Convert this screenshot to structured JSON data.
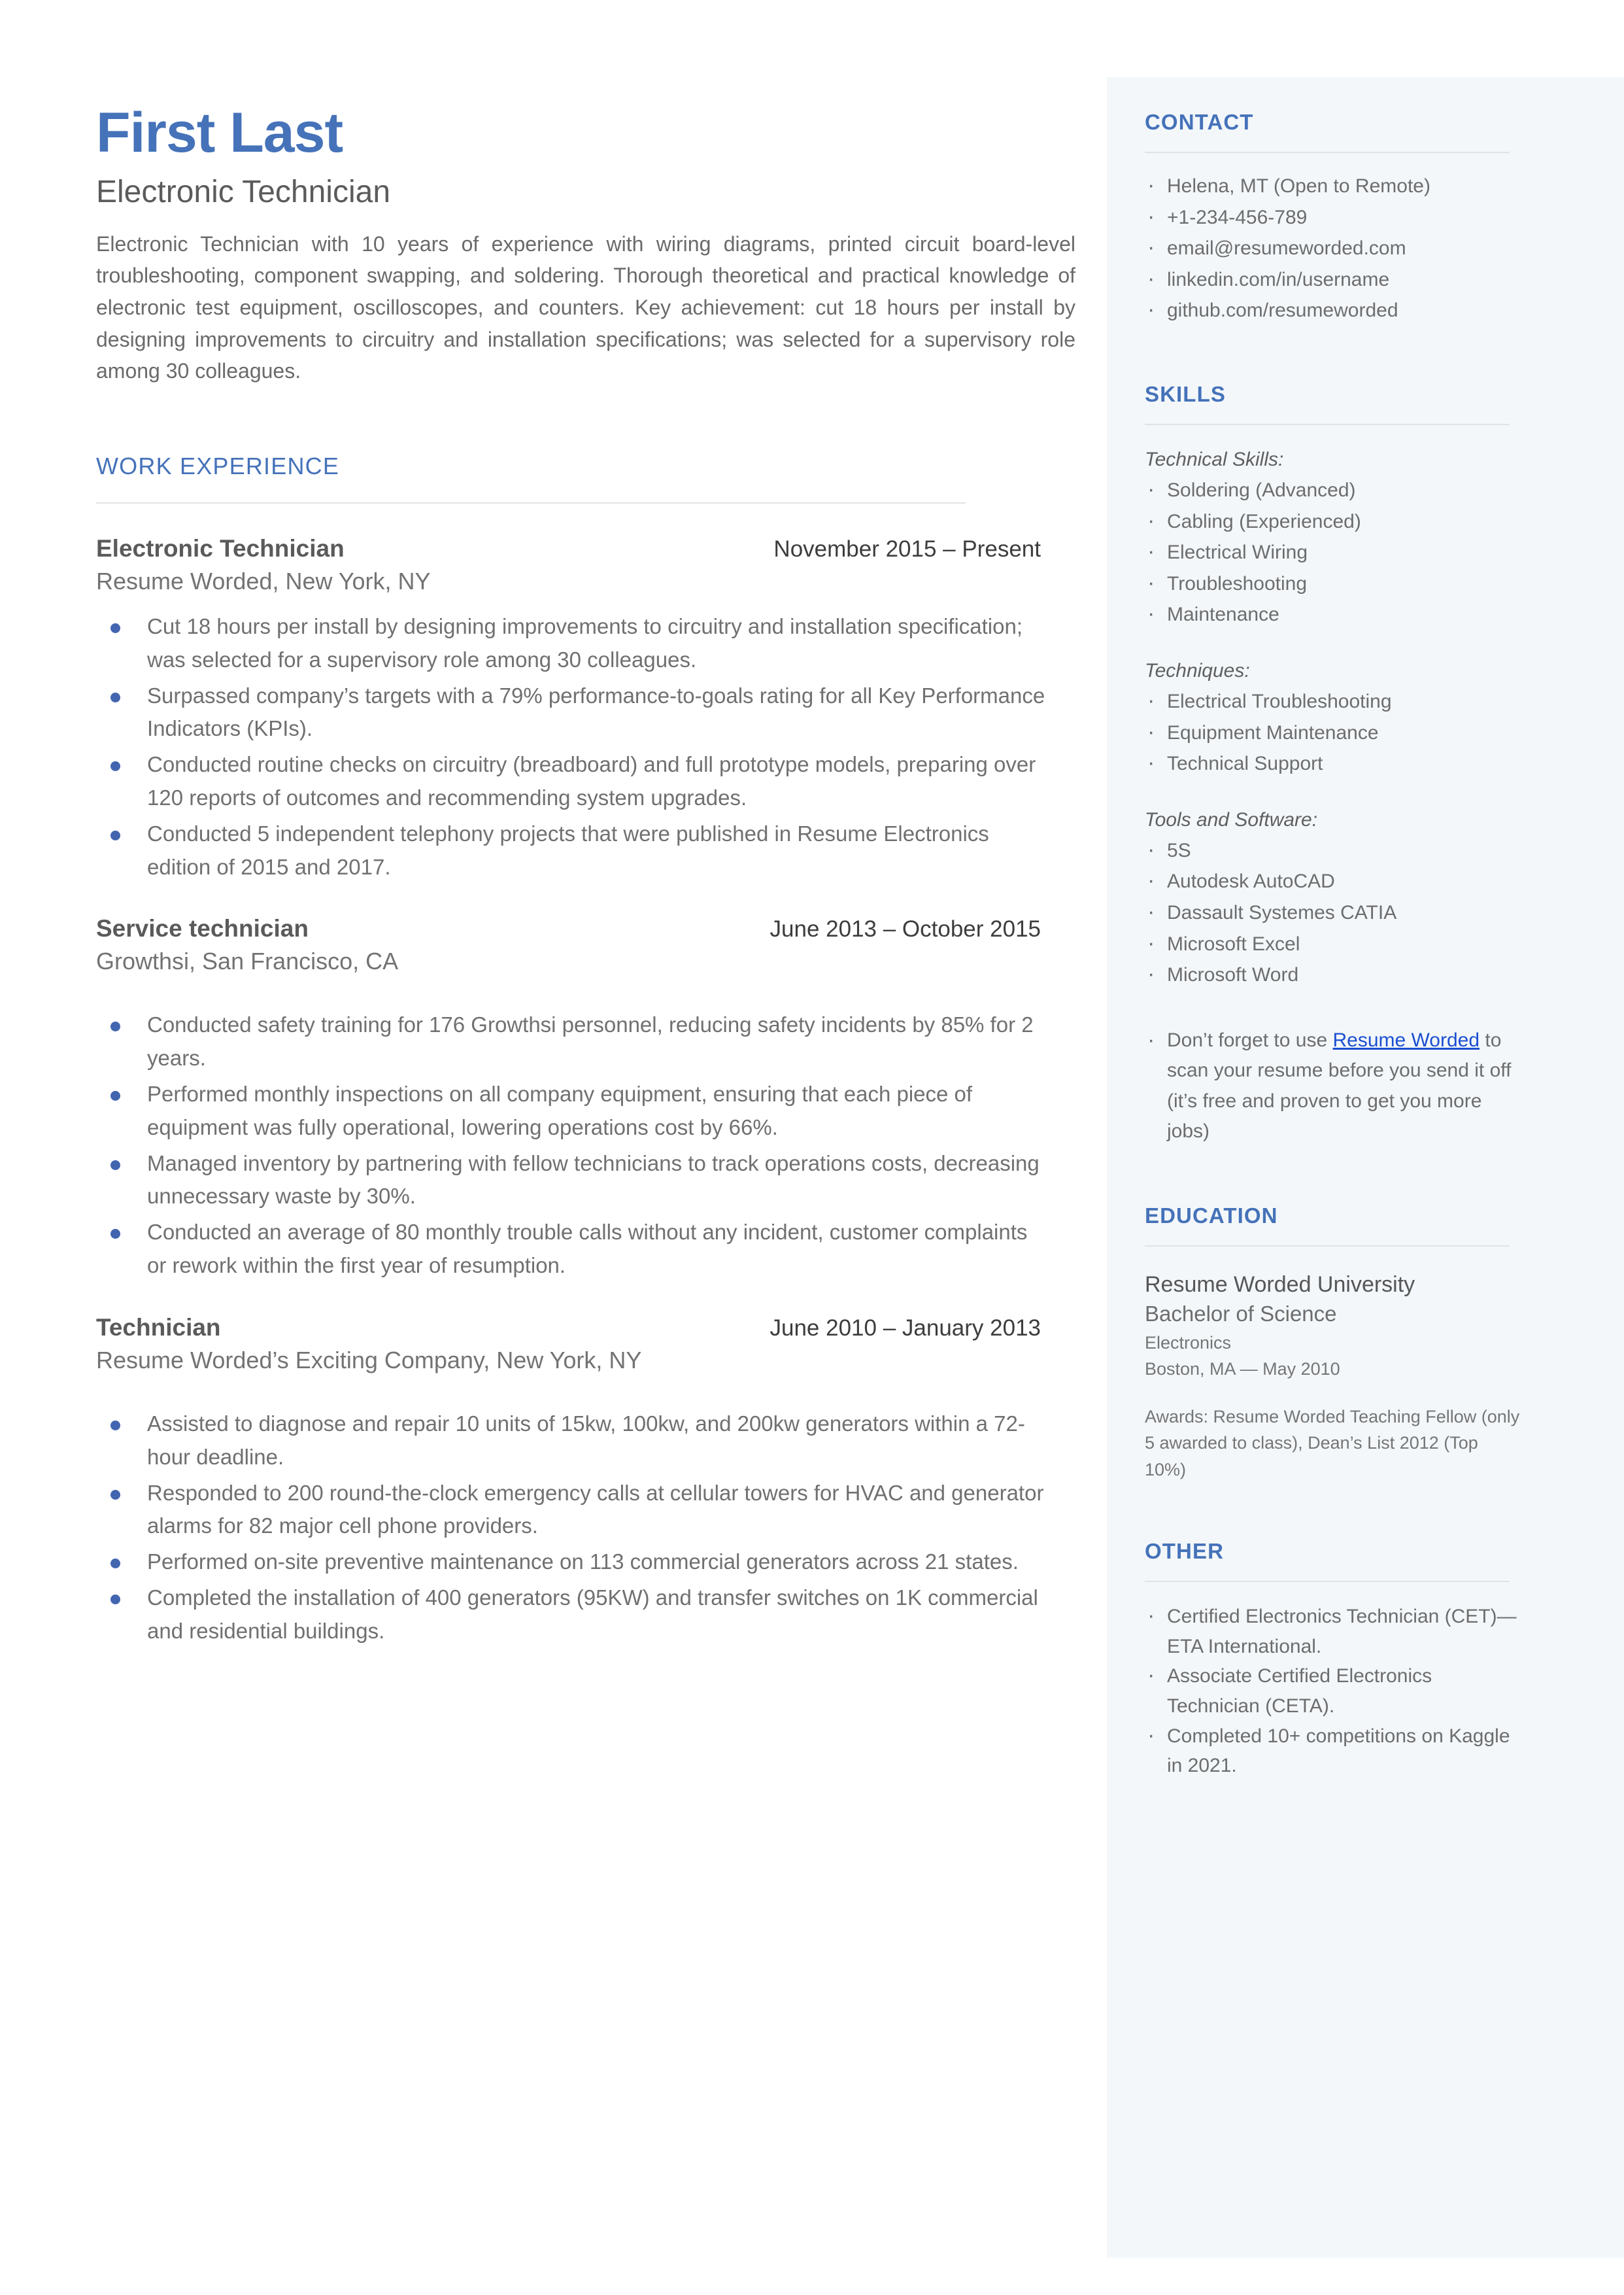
{
  "theme": {
    "accent_blue": "#4572b9",
    "bullet_blue": "#4265b0",
    "link_blue": "#1b4fd1",
    "sidebar_bg": "#f3f7fa",
    "body_text": "#6d6d6d"
  },
  "header": {
    "name": "First Last",
    "title": "Electronic Technician",
    "summary": "Electronic Technician with 10 years of experience with wiring diagrams, printed circuit board-level troubleshooting, component swapping, and soldering. Thorough theoretical and practical knowledge of electronic test equipment, oscilloscopes, and counters. Key achievement: cut 18 hours per install by designing improvements to circuitry and installation specifications; was selected for a supervisory role among 30 colleagues."
  },
  "work_experience": {
    "heading": "WORK EXPERIENCE",
    "jobs": [
      {
        "role": "Electronic Technician",
        "dates": "November 2015 – Present",
        "company": "Resume Worded, New York, NY",
        "bullets": [
          "Cut 18 hours per install by designing improvements to circuitry and installation specification; was selected for a supervisory role among 30 colleagues.",
          "Surpassed company’s targets with a 79% performance-to-goals rating for all Key Performance Indicators (KPIs).",
          "Conducted routine checks on circuitry (breadboard) and full prototype models, preparing over 120 reports of outcomes and recommending system upgrades.",
          "Conducted 5 independent telephony projects that were published in Resume Electronics edition of 2015 and 2017."
        ]
      },
      {
        "role": "Service technician",
        "dates": "June 2013 – October 2015",
        "company": "Growthsi, San Francisco, CA",
        "bullets": [
          "Conducted safety training for 176 Growthsi personnel, reducing safety incidents by 85% for 2 years.",
          "Performed monthly inspections on all company equipment, ensuring that each piece of equipment was fully operational, lowering operations cost by 66%.",
          "Managed inventory by partnering with fellow technicians to track operations costs, decreasing unnecessary waste by 30%.",
          "Conducted an average of 80 monthly trouble calls without any incident, customer complaints or rework within the first year of resumption."
        ]
      },
      {
        "role": "Technician",
        "dates": "June 2010 – January 2013",
        "company": "Resume Worded’s Exciting Company, New York, NY",
        "bullets": [
          "Assisted to diagnose and repair 10 units of 15kw, 100kw, and 200kw generators within a 72-hour deadline.",
          "Responded to 200 round-the-clock emergency calls at cellular towers for HVAC and generator alarms for 82 major cell phone providers.",
          "Performed on-site preventive maintenance on 113 commercial generators across 21 states.",
          "Completed the installation of 400 generators (95KW) and transfer switches on 1K commercial and residential buildings."
        ]
      }
    ]
  },
  "contact": {
    "heading": "CONTACT",
    "items": [
      "Helena, MT (Open to Remote)",
      "+1-234-456-789",
      "email@resumeworded.com",
      "linkedin.com/in/username",
      "github.com/resumeworded"
    ]
  },
  "skills": {
    "heading": "SKILLS",
    "groups": [
      {
        "label": "Technical Skills:",
        "items": [
          "Soldering (Advanced)",
          "Cabling (Experienced)",
          "Electrical Wiring",
          "Troubleshooting",
          "Maintenance"
        ]
      },
      {
        "label": "Techniques:",
        "items": [
          "Electrical Troubleshooting",
          "Equipment Maintenance",
          "Technical Support"
        ]
      },
      {
        "label": "Tools and Software:",
        "items": [
          "5S",
          "Autodesk AutoCAD",
          "Dassault Systemes CATIA",
          "Microsoft Excel",
          "Microsoft Word"
        ]
      }
    ],
    "promo": {
      "before_link": "Don’t forget to use ",
      "link_text": "Resume Worded",
      "after_link": " to scan your resume before you send it off (it’s free and proven to get you more jobs)"
    }
  },
  "education": {
    "heading": "EDUCATION",
    "school": "Resume Worded University",
    "degree": "Bachelor of Science",
    "field": "Electronics",
    "location_date": "Boston, MA — May 2010",
    "awards": "Awards: Resume Worded Teaching Fellow (only 5 awarded to class), Dean’s List 2012 (Top 10%)"
  },
  "other": {
    "heading": "OTHER",
    "items": [
      "Certified Electronics Technician (CET)—ETA International.",
      "Associate Certified Electronics Technician (CETA).",
      "Completed 10+ competitions on Kaggle in 2021."
    ]
  }
}
